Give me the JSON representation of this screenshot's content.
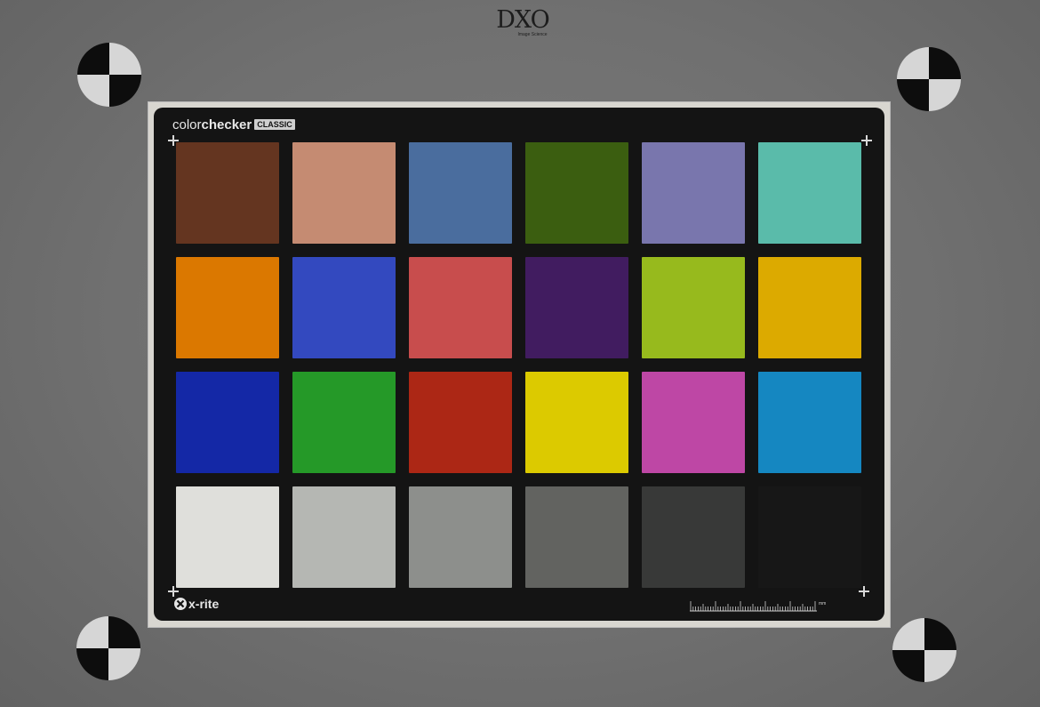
{
  "logo": {
    "word": "DXO",
    "sub": "Image Science",
    "icon": "dxo-logo-icon"
  },
  "chart": {
    "brand_light": "color",
    "brand_bold": "checker",
    "brand_badge": "CLASSIC",
    "maker": "x-rite",
    "ruler_unit": "mm",
    "colors": {
      "background": "#707070",
      "card": "#141414",
      "mat": "#d8d6d0"
    },
    "patches": [
      {
        "color": "#643520"
      },
      {
        "color": "#c58b72"
      },
      {
        "color": "#4a6d9e"
      },
      {
        "color": "#3b5e10"
      },
      {
        "color": "#7976ad"
      },
      {
        "color": "#5abbaa"
      },
      {
        "color": "#db7800"
      },
      {
        "color": "#3349bf"
      },
      {
        "color": "#c84d4d"
      },
      {
        "color": "#411c60"
      },
      {
        "color": "#97ba1d"
      },
      {
        "color": "#dcaa00"
      },
      {
        "color": "#1428a6"
      },
      {
        "color": "#259928"
      },
      {
        "color": "#ac2715"
      },
      {
        "color": "#dcca00"
      },
      {
        "color": "#be47a5"
      },
      {
        "color": "#1587c1"
      },
      {
        "color": "#dfdfdb"
      },
      {
        "color": "#b5b7b3"
      },
      {
        "color": "#8d8f8c"
      },
      {
        "color": "#626360"
      },
      {
        "color": "#383938"
      },
      {
        "color": "#171717"
      }
    ]
  }
}
